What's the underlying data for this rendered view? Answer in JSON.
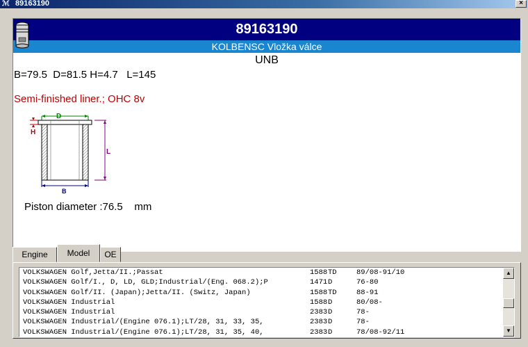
{
  "window": {
    "title": "89163190",
    "app_icon": "app-logo-icon",
    "close_label": "×"
  },
  "part": {
    "number": "89163190",
    "subtitle": "KOLBENSC Vložka válce",
    "brand": "UNB",
    "dimensions": "B=79.5  D=81.5 H=4.7   L=145",
    "description": "Semi-finished liner.; OHC 8v",
    "piston_diameter": "Piston diameter :76.5    mm",
    "diagram_labels": {
      "d": "D",
      "h": "H",
      "l": "L",
      "b": "B"
    }
  },
  "tabs": [
    {
      "label": "Engine",
      "active": false
    },
    {
      "label": "Model",
      "active": true
    },
    {
      "label": "OE",
      "active": false
    }
  ],
  "applications": [
    {
      "model": "VOLKSWAGEN Golf,Jetta/II.;Passat",
      "ccm": "1588",
      "fuel": "TD",
      "years": "89/08-91/10"
    },
    {
      "model": "VOLKSWAGEN Golf/I., D, LD, GLD;Industrial/(Eng. 068.2);P",
      "ccm": "1471",
      "fuel": "D",
      "years": "76-80"
    },
    {
      "model": "VOLKSWAGEN Golf/II. (Japan);Jetta/II. (Switz, Japan)",
      "ccm": "1588",
      "fuel": "TD",
      "years": "88-91"
    },
    {
      "model": "VOLKSWAGEN Industrial",
      "ccm": "1588",
      "fuel": "D",
      "years": "80/08-"
    },
    {
      "model": "VOLKSWAGEN Industrial",
      "ccm": "2383",
      "fuel": "D",
      "years": "78-"
    },
    {
      "model": "VOLKSWAGEN Industrial/(Engine 076.1);LT/28, 31, 33, 35,",
      "ccm": "2383",
      "fuel": "D",
      "years": "78-"
    },
    {
      "model": "VOLKSWAGEN Industrial/(Engine 076.1);LT/28, 31, 35, 40,",
      "ccm": "2383",
      "fuel": "D",
      "years": "78/08-92/11"
    }
  ],
  "scrollbar": {
    "up": "▲",
    "down": "▼"
  },
  "colors": {
    "header": "#000080",
    "subheader": "#1a86d0",
    "description": "#c00000"
  }
}
